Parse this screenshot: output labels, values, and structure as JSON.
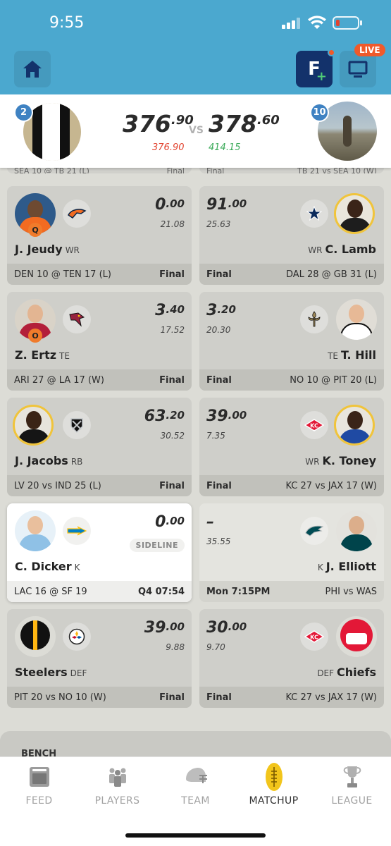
{
  "status_bar": {
    "time": "9:55"
  },
  "header": {
    "live_label": "LIVE",
    "f_label": "F"
  },
  "score": {
    "left": {
      "rank": "2",
      "whole": "376",
      "frac": ".90",
      "projection": "376.90"
    },
    "vs": "VS",
    "right": {
      "rank": "10",
      "whole": "378",
      "frac": ".60",
      "projection": "414.15"
    }
  },
  "peek": {
    "left": "SEA 10 @ TB 21 (L)",
    "left_status": "Final",
    "right_status": "Final",
    "right": "TB 21 vs SEA 10 (W)"
  },
  "rows": [
    {
      "left": {
        "whole": "0",
        "frac": ".00",
        "proj": "21.08",
        "name": "J. Jeudy",
        "pos": "WR",
        "game": "DEN 10 @ TEN 17 (L)",
        "status": "Final",
        "injury": "Q",
        "team_icon": "broncos-icon"
      },
      "right": {
        "whole": "91",
        "frac": ".00",
        "proj": "25.63",
        "name": "C. Lamb",
        "pos": "WR",
        "game": "DAL 28 @ GB 31 (L)",
        "status": "Final",
        "team_icon": "cowboys-icon"
      }
    },
    {
      "left": {
        "whole": "3",
        "frac": ".40",
        "proj": "17.52",
        "name": "Z. Ertz",
        "pos": "TE",
        "game": "ARI 27 @ LA 17 (W)",
        "status": "Final",
        "injury": "O",
        "team_icon": "cardinals-icon"
      },
      "right": {
        "whole": "3",
        "frac": ".20",
        "proj": "20.30",
        "name": "T. Hill",
        "pos": "TE",
        "game": "NO 10 @ PIT 20 (L)",
        "status": "Final",
        "team_icon": "saints-icon"
      }
    },
    {
      "left": {
        "whole": "63",
        "frac": ".20",
        "proj": "30.52",
        "name": "J. Jacobs",
        "pos": "RB",
        "game": "LV 20 vs IND 25 (L)",
        "status": "Final",
        "team_icon": "raiders-icon"
      },
      "right": {
        "whole": "39",
        "frac": ".00",
        "proj": "7.35",
        "name": "K. Toney",
        "pos": "WR",
        "game": "KC 27 vs JAX 17 (W)",
        "status": "Final",
        "team_icon": "chiefs-icon"
      }
    },
    {
      "left": {
        "whole": "0",
        "frac": ".00",
        "sideline": "SIDELINE",
        "name": "C. Dicker",
        "pos": "K",
        "game": "LAC 16 @ SF 19",
        "status": "Q4 07:54",
        "team_icon": "chargers-icon"
      },
      "right": {
        "dash": "–",
        "proj": "35.55",
        "name": "J. Elliott",
        "pos": "K",
        "game": "PHI vs WAS",
        "status": "Mon 7:15PM",
        "team_icon": "eagles-icon"
      }
    },
    {
      "left": {
        "whole": "39",
        "frac": ".00",
        "proj": "9.88",
        "name": "Steelers",
        "pos": "DEF",
        "game": "PIT 20 vs NO 10 (W)",
        "status": "Final",
        "team_icon": "steelers-icon"
      },
      "right": {
        "whole": "30",
        "frac": ".00",
        "proj": "9.70",
        "name": "Chiefs",
        "pos": "DEF",
        "game": "KC 27 vs JAX 17 (W)",
        "status": "Final",
        "team_icon": "chiefs-icon"
      }
    }
  ],
  "bench": {
    "label": "BENCH"
  },
  "tabs": [
    {
      "label": "FEED",
      "icon": "feed-icon"
    },
    {
      "label": "PLAYERS",
      "icon": "players-icon"
    },
    {
      "label": "TEAM",
      "icon": "helmet-icon"
    },
    {
      "label": "MATCHUP",
      "icon": "football-icon",
      "active": true
    },
    {
      "label": "LEAGUE",
      "icon": "trophy-icon"
    }
  ],
  "colors": {
    "header_blue": "#4ba8cf",
    "navy": "#13326b",
    "live_orange": "#f05a2b",
    "loss_red": "#e2432f",
    "win_green": "#3cab5a",
    "gold_ring": "#f0c43b"
  }
}
